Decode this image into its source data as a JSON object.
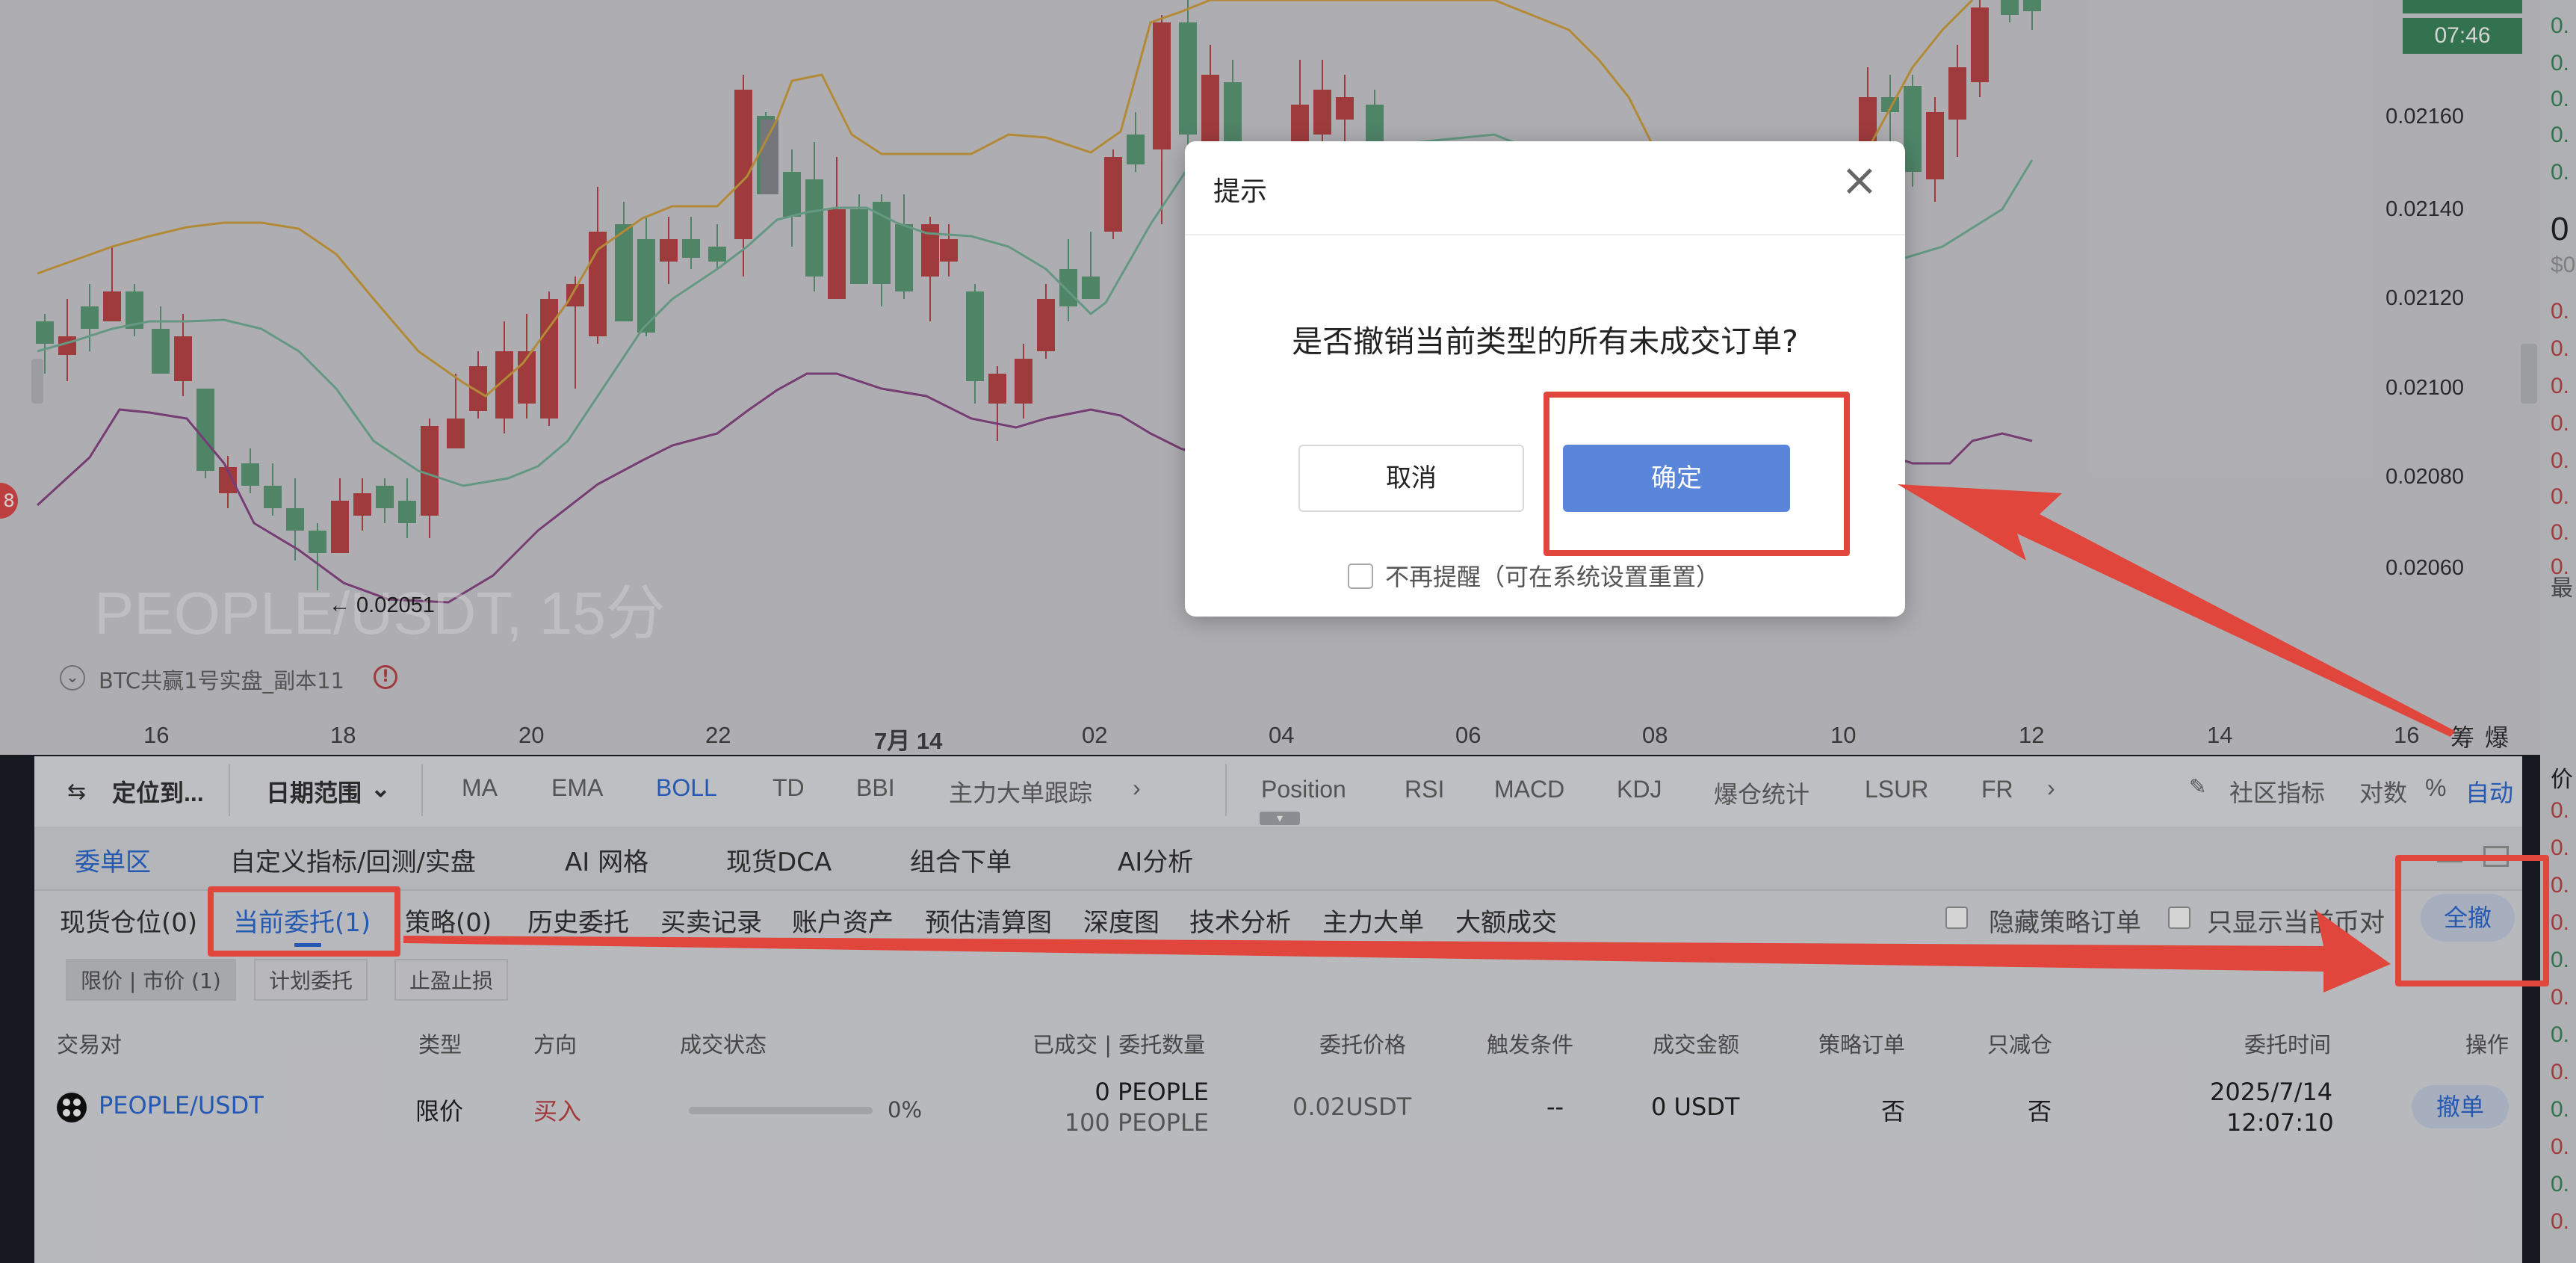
{
  "chart": {
    "price_ticks": [
      "0.02160",
      "0.02140",
      "0.02120",
      "0.02100",
      "0.02080",
      "0.02060"
    ],
    "time_ticks": [
      "16",
      "18",
      "20",
      "22",
      "7月 14",
      "02",
      "04",
      "06",
      "08",
      "10",
      "12",
      "14",
      "16"
    ],
    "time_badge": "07:46",
    "watermark": "PEOPLE/USDT, 15分",
    "low_marker": "← 0.02051",
    "strategy_label": "BTC共赢1号实盘_副本11",
    "right_flags": [
      "筹",
      "爆"
    ],
    "right_cut_text": [
      "0.",
      "0.",
      "0.",
      "0.",
      "0.",
      "0",
      "$0",
      "0.",
      "0.",
      "0.",
      "0.",
      "0.",
      "0.",
      "0.",
      "0.",
      "最"
    ],
    "right_cut_text2": [
      "价",
      "0.",
      "0.",
      "0.",
      "0.",
      "0.",
      "0.",
      "0.",
      "0.",
      "0.",
      "0.",
      "0.",
      "0."
    ],
    "colors": {
      "up": "#5f9f7c",
      "down": "#c0474a",
      "ma_upper": "#d6a743",
      "ma_mid": "#79b79d",
      "ma_low": "#8e4a8c"
    }
  },
  "toolbar": {
    "locate": "定位到...",
    "date_range": "日期范围",
    "indicators_main": [
      "MA",
      "EMA",
      "BOLL",
      "TD",
      "BBI",
      "主力大单跟踪"
    ],
    "active_indicator": "BOLL",
    "indicators_sub": [
      "Position",
      "RSI",
      "MACD",
      "KDJ",
      "爆仓统计",
      "LSUR",
      "FR"
    ],
    "community": "社区指标",
    "log": "对数",
    "percent": "%",
    "auto": "自动"
  },
  "panel_tabs": [
    "委单区",
    "自定义指标/回测/实盘",
    "AI 网格",
    "现货DCA",
    "组合下单",
    "AI分析"
  ],
  "order_tabs": [
    "现货仓位(0)",
    "当前委托(1)",
    "策略(0)",
    "历史委托",
    "买卖记录",
    "账户资产",
    "预估清算图",
    "深度图",
    "技术分析",
    "主力大单",
    "大额成交"
  ],
  "options": {
    "hide_strategy": "隐藏策略订单",
    "current_pair_only": "只显示当前币对",
    "cancel_all": "全撤"
  },
  "filters": [
    "限价 | 市价 (1)",
    "计划委托",
    "止盈止损"
  ],
  "table": {
    "headers": [
      "交易对",
      "类型",
      "方向",
      "成交状态",
      "已成交 | 委托数量",
      "委托价格",
      "触发条件",
      "成交金额",
      "策略订单",
      "只减仓",
      "委托时间",
      "操作"
    ],
    "rows": [
      {
        "pair": "PEOPLE/USDT",
        "type": "限价",
        "side": "买入",
        "progress": 0,
        "progress_text": "0%",
        "filled": "0 PEOPLE",
        "amount": "100 PEOPLE",
        "price": "0.02USDT",
        "trigger": "--",
        "total": "0 USDT",
        "strategy": "否",
        "reduce_only": "否",
        "date": "2025/7/14",
        "time": "12:07:10",
        "action": "撤单"
      }
    ]
  },
  "dialog": {
    "title": "提示",
    "message": "是否撤销当前类型的所有未成交订单?",
    "cancel": "取消",
    "confirm": "确定",
    "checkbox": "不再提醒（可在系统设置重置）"
  }
}
